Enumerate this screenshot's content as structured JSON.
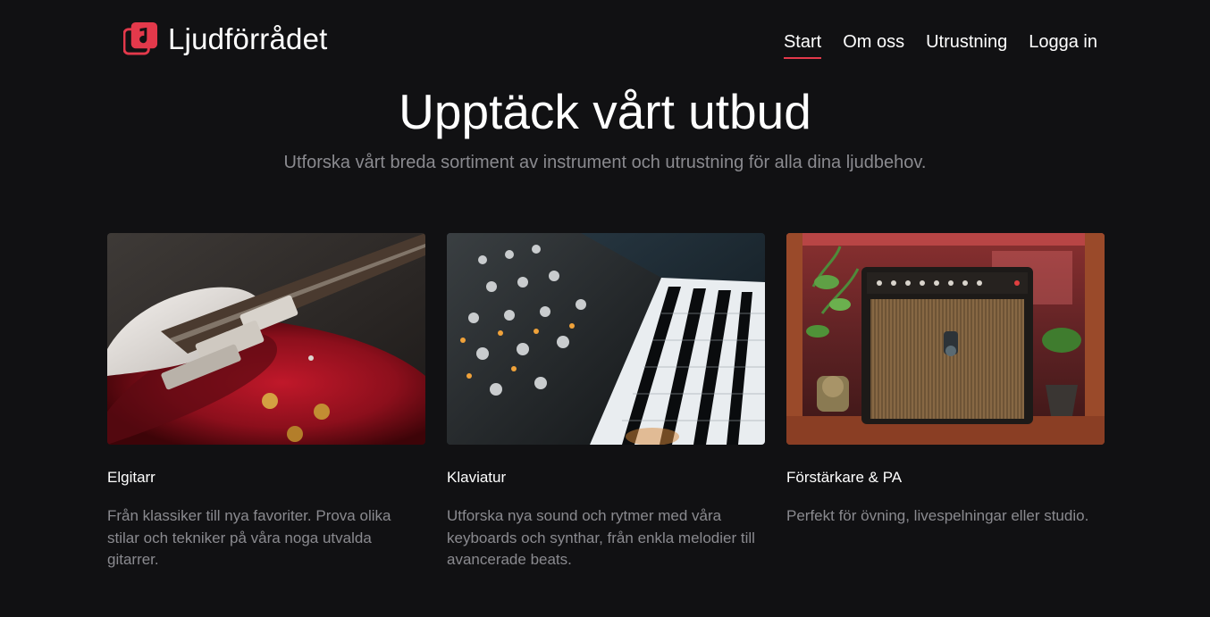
{
  "brand": {
    "name": "Ljudförrådet",
    "accent_color": "#e3394b"
  },
  "nav": {
    "items": [
      {
        "label": "Start",
        "active": true
      },
      {
        "label": "Om oss",
        "active": false
      },
      {
        "label": "Utrustning",
        "active": false
      },
      {
        "label": "Logga in",
        "active": false
      }
    ]
  },
  "hero": {
    "title": "Upptäck vårt utbud",
    "subtitle": "Utforska vårt breda sortiment av instrument och utrustning för alla dina ljudbehov."
  },
  "cards": [
    {
      "title": "Elgitarr",
      "text": "Från klassiker till nya favoriter. Prova olika stilar och tekniker på våra noga utvalda gitarrer."
    },
    {
      "title": "Klaviatur",
      "text": "Utforska nya sound och rytmer med våra keyboards och synthar, från enkla melodier till avancerade beats."
    },
    {
      "title": "Förstärkare & PA",
      "text": "Perfekt för övning, livespelningar eller studio."
    }
  ]
}
